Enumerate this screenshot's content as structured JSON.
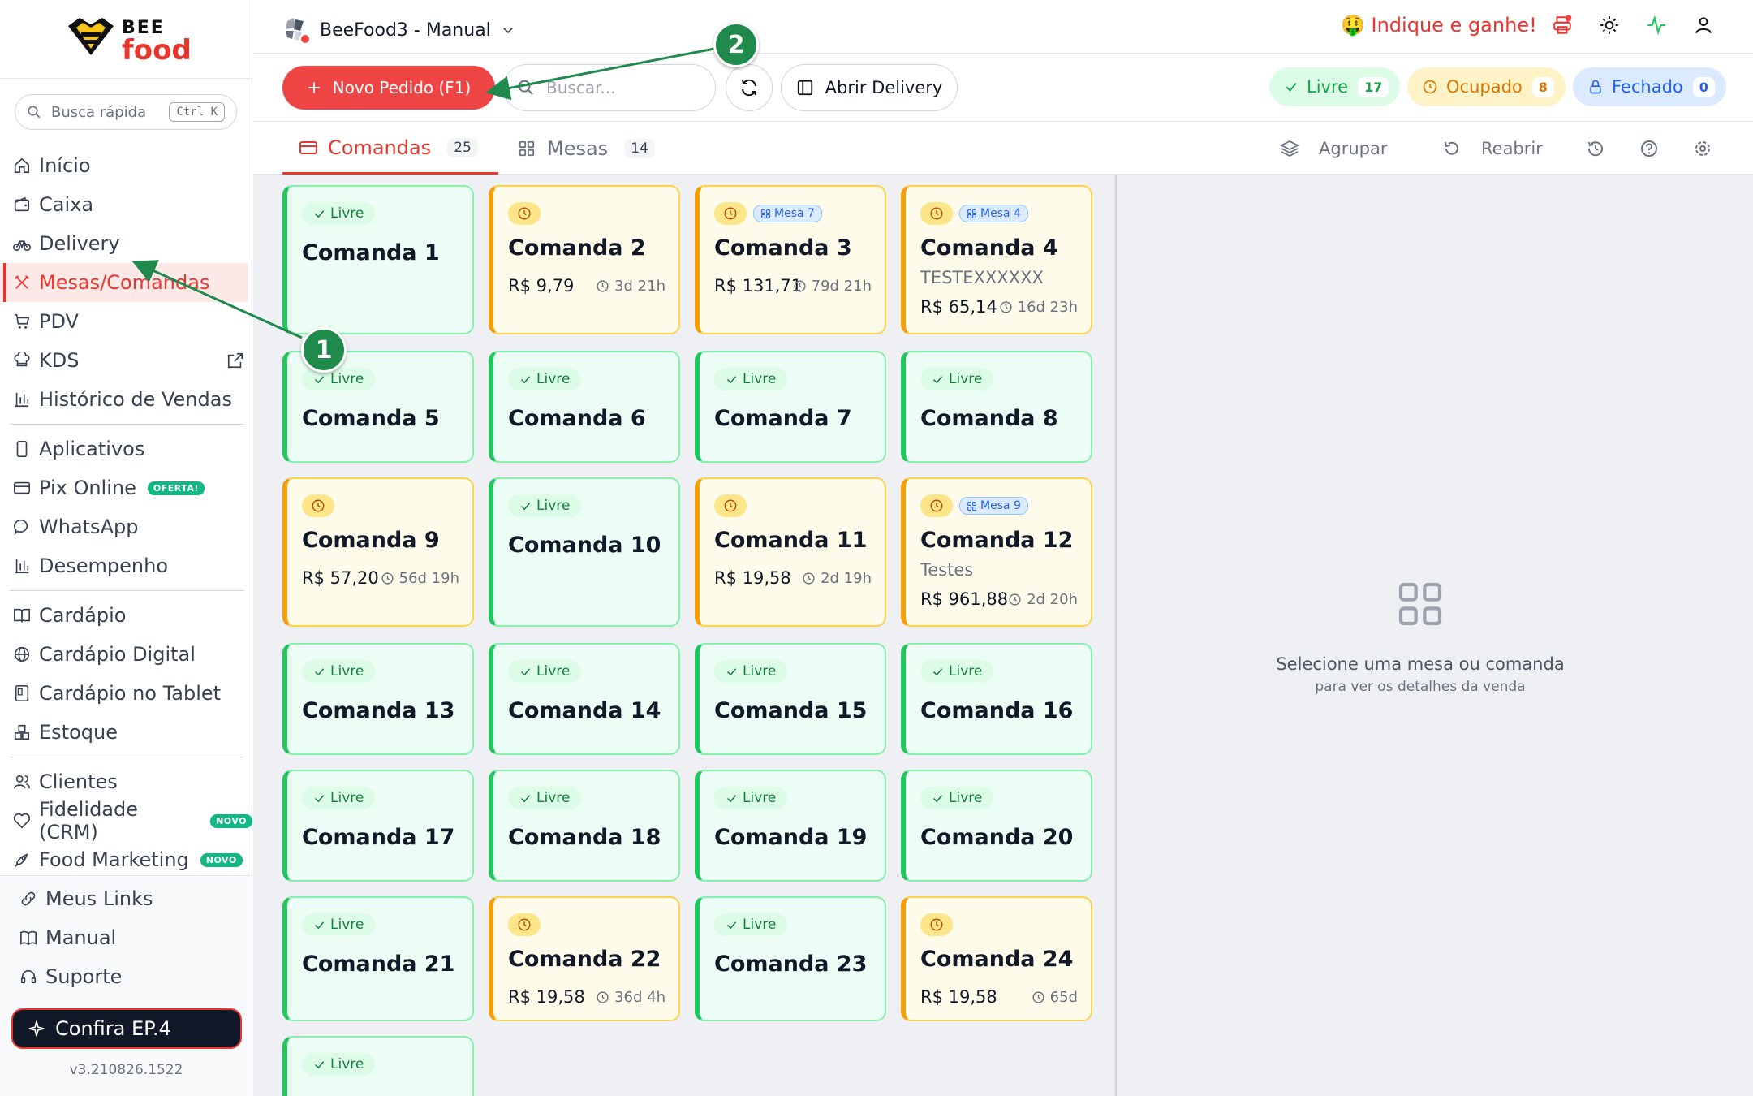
{
  "logo": {
    "top_word": "BEE",
    "bottom_word": "food"
  },
  "quick_search": {
    "label": "Busca rápida",
    "shortcut": "Ctrl K"
  },
  "sidebar": {
    "groups": [
      [
        {
          "label": "Início",
          "icon": "home-icon"
        },
        {
          "label": "Caixa",
          "icon": "wallet-icon"
        },
        {
          "label": "Delivery",
          "icon": "bike-icon"
        },
        {
          "label": "Mesas/Comandas",
          "icon": "utensils-icon",
          "active": true
        },
        {
          "label": "PDV",
          "icon": "cart-icon"
        },
        {
          "label": "KDS",
          "icon": "chef-hat-icon",
          "external": true
        },
        {
          "label": "Histórico de Vendas",
          "icon": "bar-chart-icon"
        }
      ],
      [
        {
          "label": "Aplicativos",
          "icon": "phone-icon"
        },
        {
          "label": "Pix Online",
          "icon": "card-icon",
          "badge": "OFERTA!"
        },
        {
          "label": "WhatsApp",
          "icon": "chat-icon"
        },
        {
          "label": "Desempenho",
          "icon": "bar-chart-icon"
        }
      ],
      [
        {
          "label": "Cardápio",
          "icon": "book-icon"
        },
        {
          "label": "Cardápio Digital",
          "icon": "globe-icon"
        },
        {
          "label": "Cardápio no Tablet",
          "icon": "tablet-icon"
        },
        {
          "label": "Estoque",
          "icon": "boxes-icon"
        }
      ],
      [
        {
          "label": "Clientes",
          "icon": "users-icon"
        },
        {
          "label": "Fidelidade (CRM)",
          "icon": "heart-icon",
          "badge": "NOVO"
        },
        {
          "label": "Food Marketing",
          "icon": "rocket-icon",
          "badge": "NOVO"
        }
      ]
    ],
    "bottom": [
      {
        "label": "Meus Links",
        "icon": "link-icon"
      },
      {
        "label": "Manual",
        "icon": "book-open-icon"
      },
      {
        "label": "Suporte",
        "icon": "headset-icon"
      }
    ],
    "confira": "Confira EP.4",
    "version": "v3.210826.1522"
  },
  "topbar": {
    "store_name": "BeeFood3 - Manual",
    "indique": "🤑 Indique e ganhe!"
  },
  "toolbar": {
    "new_order": "Novo Pedido (F1)",
    "search_placeholder": "Buscar...",
    "open_delivery": "Abrir Delivery",
    "status": {
      "livre": {
        "label": "Livre",
        "count": "17"
      },
      "ocupado": {
        "label": "Ocupado",
        "count": "8"
      },
      "fechado": {
        "label": "Fechado",
        "count": "0"
      }
    }
  },
  "tabs": {
    "comandas": {
      "label": "Comandas",
      "count": "25"
    },
    "mesas": {
      "label": "Mesas",
      "count": "14"
    },
    "agrupar": "Agrupar",
    "reabrir": "Reabrir"
  },
  "cards": [
    {
      "name": "Comanda 1",
      "status": "livre",
      "status_label": "Livre"
    },
    {
      "name": "Comanda 2",
      "status": "ocupado",
      "price": "R$ 9,79",
      "time": "3d 21h"
    },
    {
      "name": "Comanda 3",
      "status": "ocupado",
      "mesa": "Mesa 7",
      "price": "R$ 131,71",
      "time": "79d 21h"
    },
    {
      "name": "Comanda 4",
      "status": "ocupado",
      "mesa": "Mesa 4",
      "note": "TESTEXXXXXX",
      "price": "R$ 65,14",
      "time": "16d 23h"
    },
    {
      "name": "Comanda 5",
      "status": "livre",
      "status_label": "Livre"
    },
    {
      "name": "Comanda 6",
      "status": "livre",
      "status_label": "Livre"
    },
    {
      "name": "Comanda 7",
      "status": "livre",
      "status_label": "Livre"
    },
    {
      "name": "Comanda 8",
      "status": "livre",
      "status_label": "Livre"
    },
    {
      "name": "Comanda 9",
      "status": "ocupado",
      "price": "R$ 57,20",
      "time": "56d 19h"
    },
    {
      "name": "Comanda 10",
      "status": "livre",
      "status_label": "Livre"
    },
    {
      "name": "Comanda 11",
      "status": "ocupado",
      "price": "R$ 19,58",
      "time": "2d 19h"
    },
    {
      "name": "Comanda 12",
      "status": "ocupado",
      "mesa": "Mesa 9",
      "note": "Testes",
      "price": "R$ 961,88",
      "time": "2d 20h"
    },
    {
      "name": "Comanda 13",
      "status": "livre",
      "status_label": "Livre"
    },
    {
      "name": "Comanda 14",
      "status": "livre",
      "status_label": "Livre"
    },
    {
      "name": "Comanda 15",
      "status": "livre",
      "status_label": "Livre"
    },
    {
      "name": "Comanda 16",
      "status": "livre",
      "status_label": "Livre"
    },
    {
      "name": "Comanda 17",
      "status": "livre",
      "status_label": "Livre"
    },
    {
      "name": "Comanda 18",
      "status": "livre",
      "status_label": "Livre"
    },
    {
      "name": "Comanda 19",
      "status": "livre",
      "status_label": "Livre"
    },
    {
      "name": "Comanda 20",
      "status": "livre",
      "status_label": "Livre"
    },
    {
      "name": "Comanda 21",
      "status": "livre",
      "status_label": "Livre"
    },
    {
      "name": "Comanda 22",
      "status": "ocupado",
      "price": "R$ 19,58",
      "time": "36d 4h"
    },
    {
      "name": "Comanda 23",
      "status": "livre",
      "status_label": "Livre"
    },
    {
      "name": "Comanda 24",
      "status": "ocupado",
      "price": "R$ 19,58",
      "time": "65d"
    },
    {
      "name": "",
      "status": "livre",
      "status_label": "Livre"
    }
  ],
  "detail": {
    "empty_title": "Selecione uma mesa ou comanda",
    "empty_sub": "para ver os detalhes da venda"
  },
  "annotations": [
    {
      "number": "1"
    },
    {
      "number": "2"
    }
  ],
  "colors": {
    "brand": "#e8362e",
    "livre": "#22c55e",
    "ocupado": "#f59e0b",
    "fechado": "#2563eb",
    "annotation": "#1f8a4c"
  }
}
